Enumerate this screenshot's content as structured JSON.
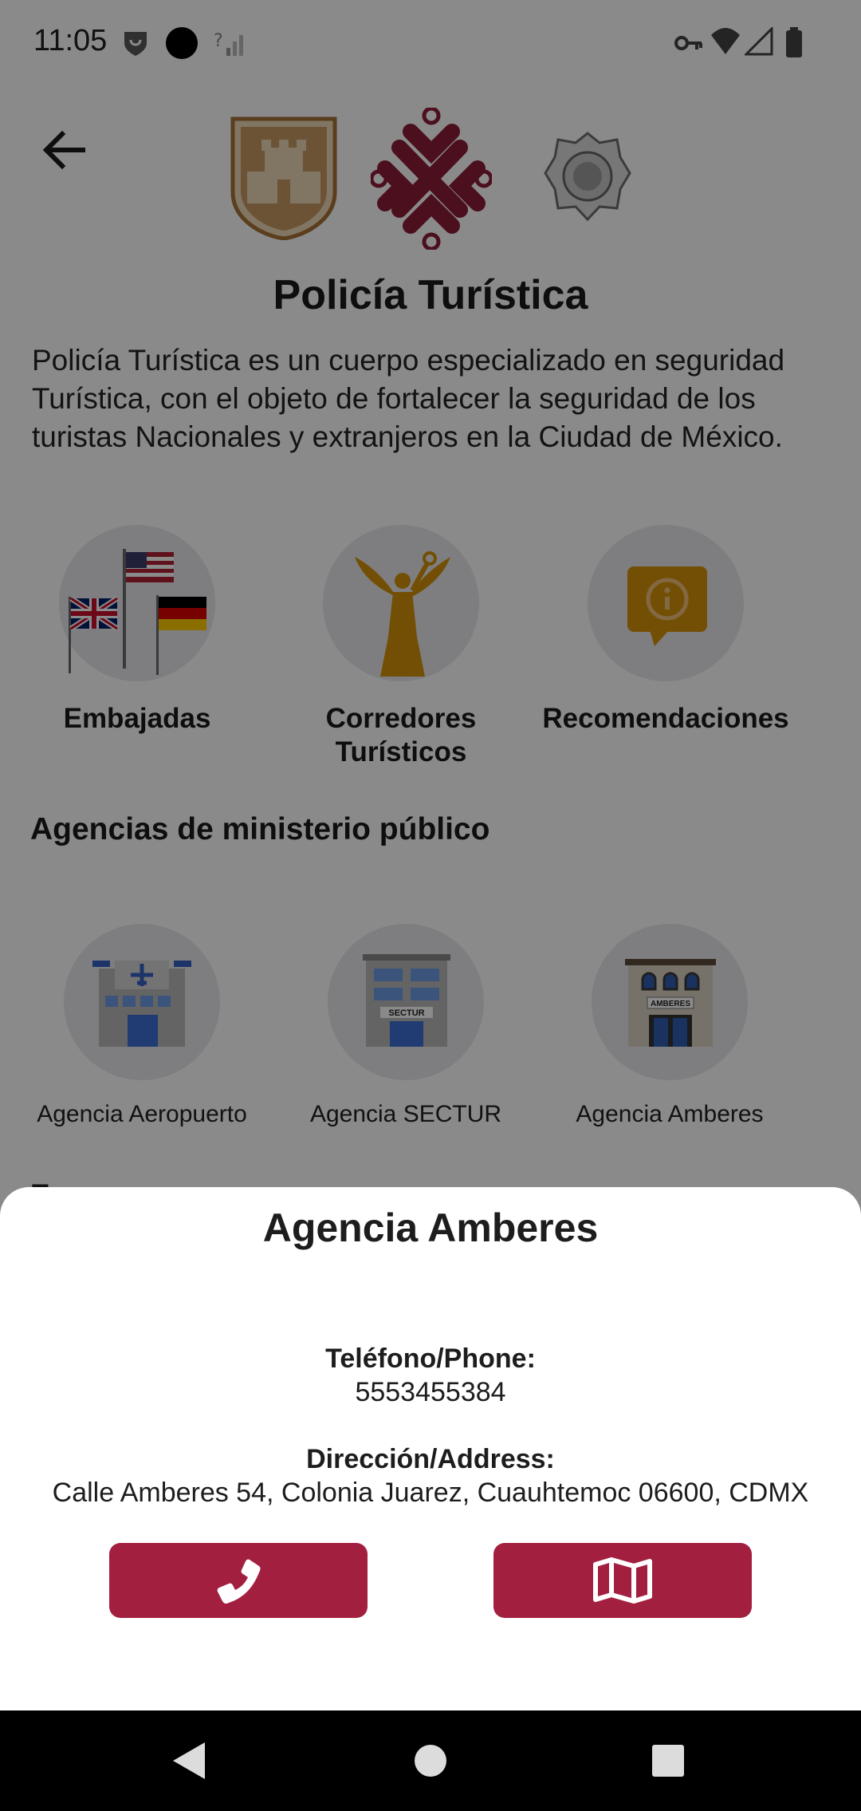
{
  "status_bar": {
    "time": "11:05"
  },
  "header": {
    "title": "Policía Turística",
    "description": "Policía Turística es un cuerpo especializado en seguridad Turística, con el objeto de fortalecer la seguridad de los turistas Nacionales y extranjeros en la Ciudad de México."
  },
  "categories": [
    {
      "label": "Embajadas",
      "icon": "flags-icon"
    },
    {
      "label": "Corredores Turísticos",
      "icon": "angel-statue-icon"
    },
    {
      "label": "Recomendaciones",
      "icon": "info-bubble-icon"
    }
  ],
  "agencies_section": {
    "title": "Agencias de ministerio público",
    "items": [
      {
        "label": "Agencia Aeropuerto",
        "icon": "airport-building-icon"
      },
      {
        "label": "Agencia SECTUR",
        "icon": "sectur-building-icon",
        "sign": "SECTUR"
      },
      {
        "label": "Agencia Amberes",
        "icon": "amberes-building-icon",
        "sign": "AMBERES"
      }
    ],
    "next_partial": "T"
  },
  "sheet": {
    "title": "Agencia Amberes",
    "phone_label": "Teléfono/Phone:",
    "phone": "5553455384",
    "address_label": "Dirección/Address:",
    "address": "Calle Amberes 54, Colonia Juarez, Cuauhtemoc 06600, CDMX",
    "call_icon": "phone-icon",
    "map_icon": "map-icon"
  },
  "colors": {
    "accent": "#a31f40",
    "scrim": "rgba(0,0,0,0.46)",
    "gold": "#d4920b"
  }
}
